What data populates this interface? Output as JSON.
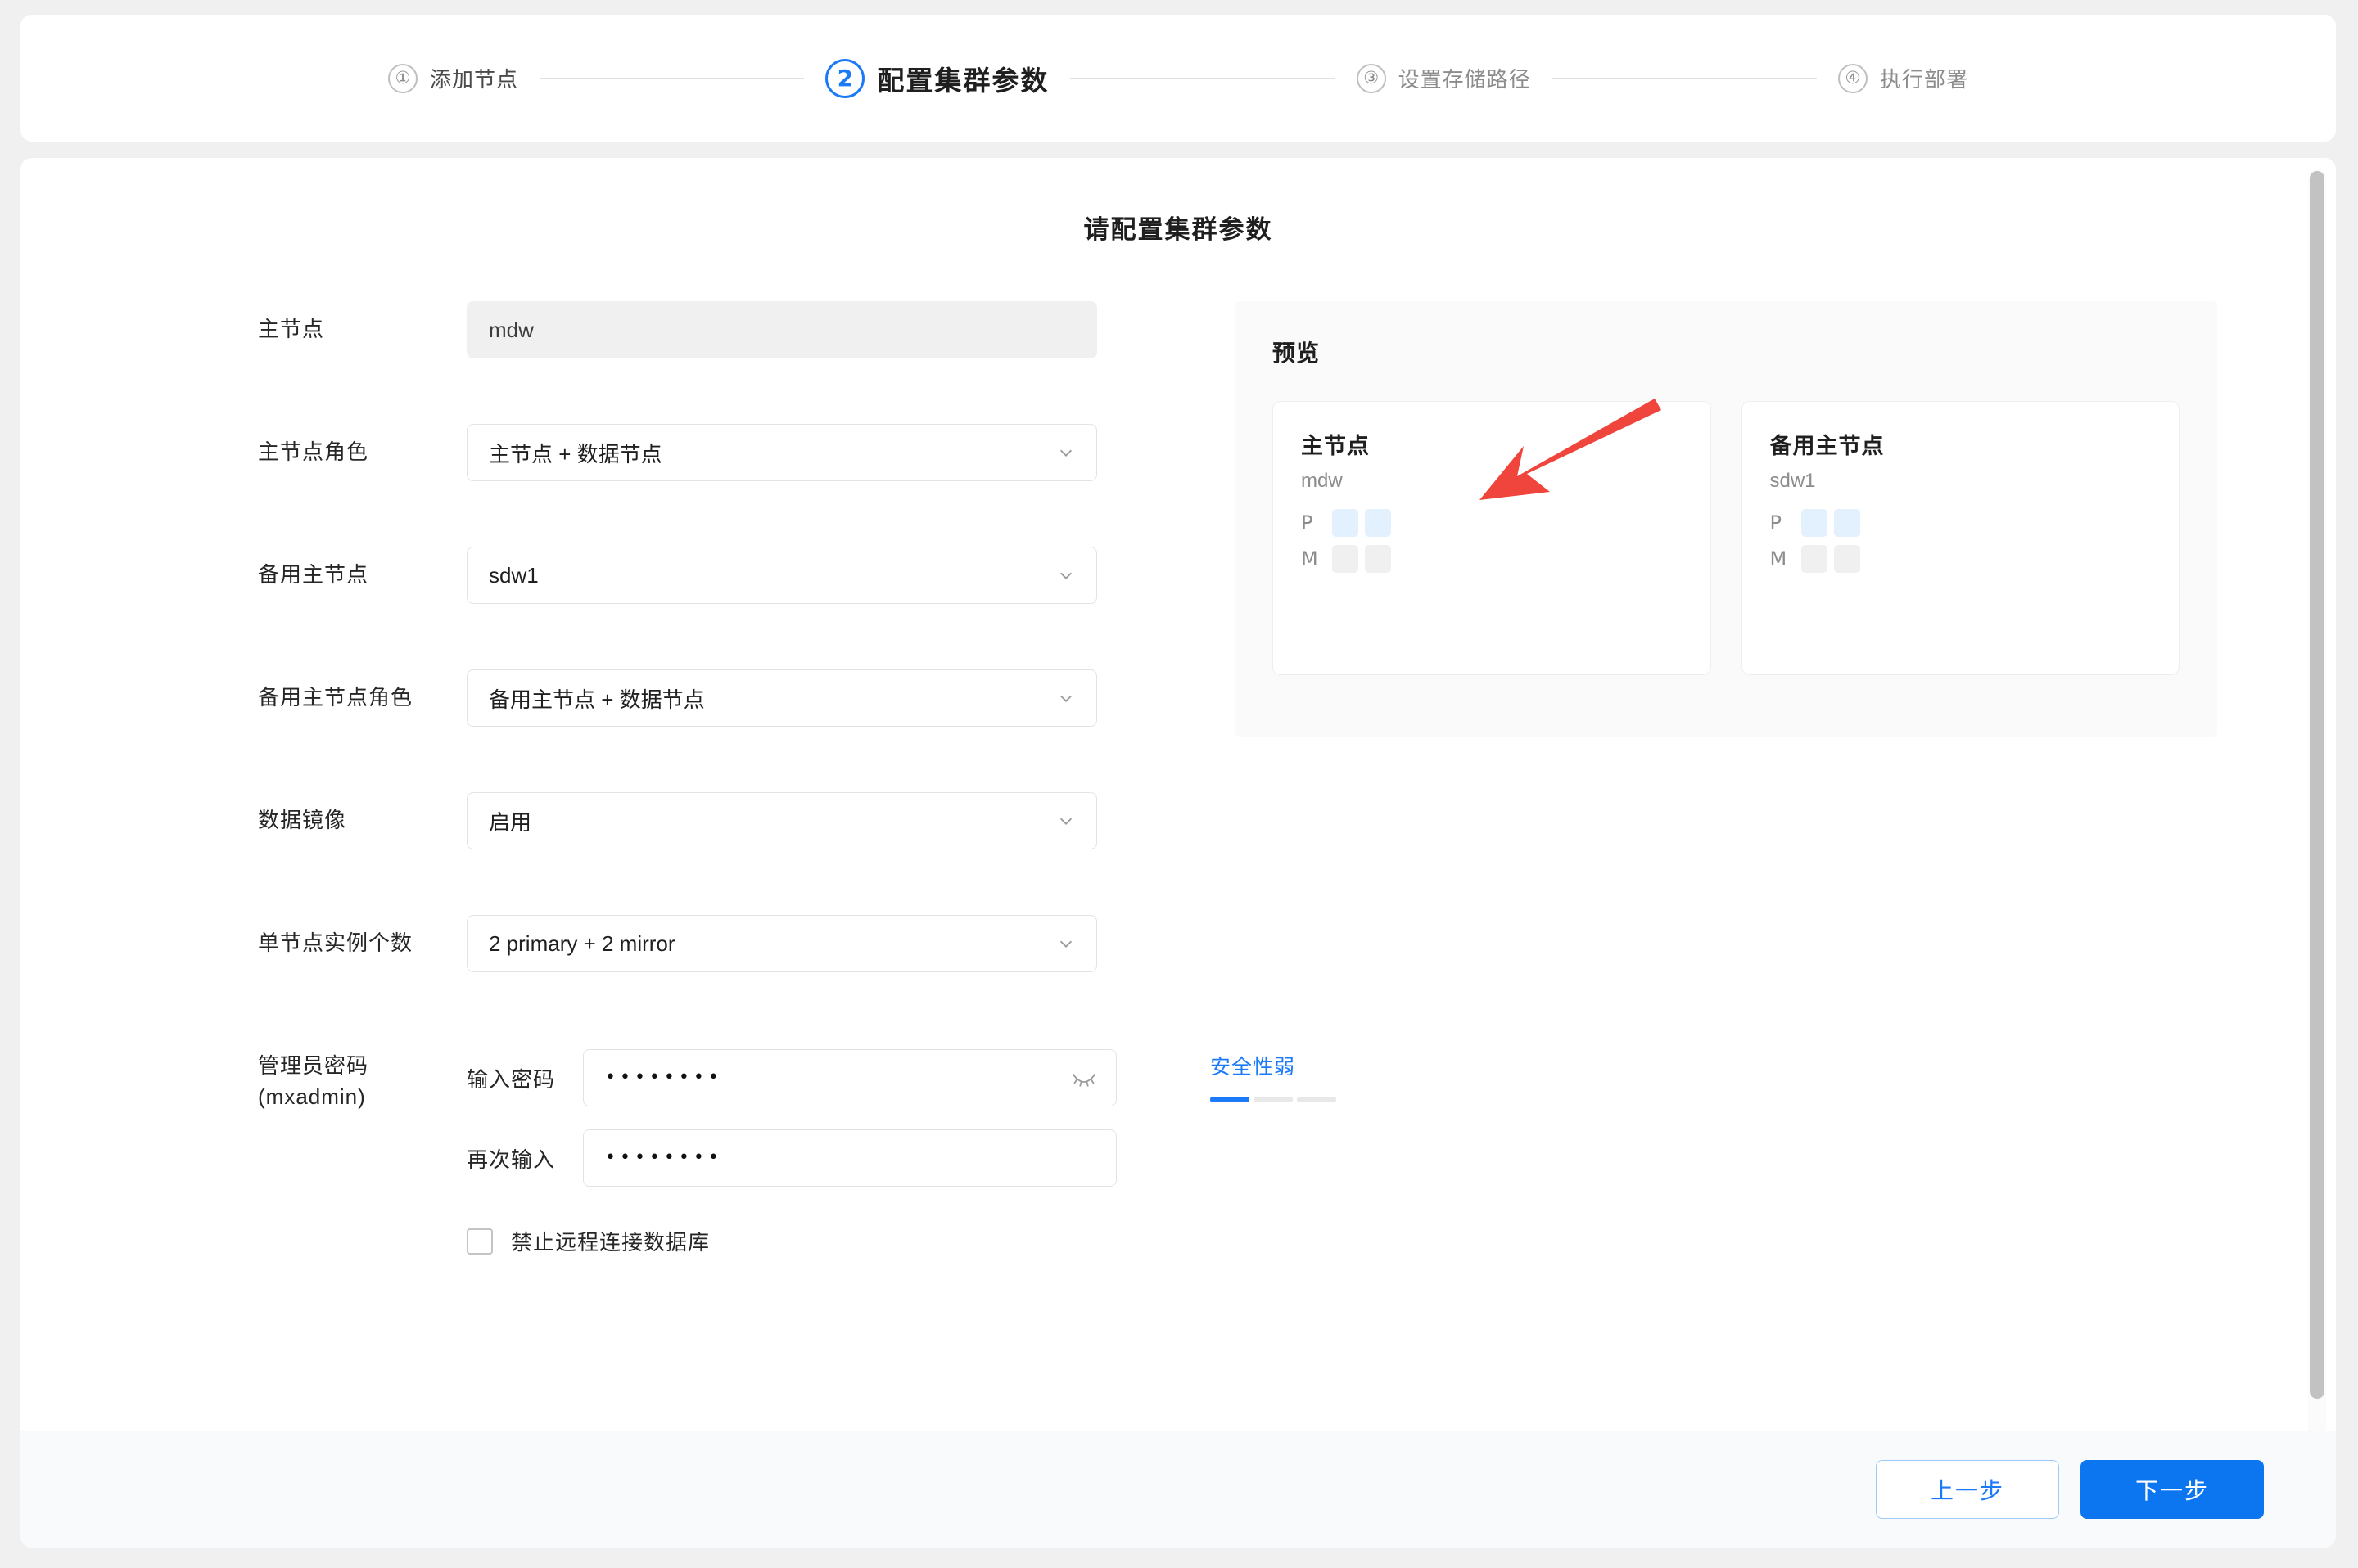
{
  "steps": [
    {
      "num": "①",
      "label": "添加节点",
      "state": "done"
    },
    {
      "num": "2",
      "label": "配置集群参数",
      "state": "active"
    },
    {
      "num": "③",
      "label": "设置存储路径",
      "state": "pending"
    },
    {
      "num": "④",
      "label": "执行部署",
      "state": "pending"
    }
  ],
  "page_title": "请配置集群参数",
  "form": {
    "master_node": {
      "label": "主节点",
      "value": "mdw"
    },
    "master_role": {
      "label": "主节点角色",
      "value": "主节点 + 数据节点"
    },
    "standby_node": {
      "label": "备用主节点",
      "value": "sdw1"
    },
    "standby_role": {
      "label": "备用主节点角色",
      "value": "备用主节点 + 数据节点"
    },
    "data_mirror": {
      "label": "数据镜像",
      "value": "启用"
    },
    "instances_per_node": {
      "label": "单节点实例个数",
      "value": "2 primary + 2 mirror"
    },
    "admin_password": {
      "label_line1": "管理员密码",
      "label_line2": "(mxadmin)",
      "enter_label": "输入密码",
      "enter_value": "••••••••",
      "repeat_label": "再次输入",
      "repeat_value": "••••••••",
      "strength_text": "安全性弱",
      "strength_level": 1,
      "strength_segments": 3,
      "strength_color": "#1a7af8"
    },
    "disable_remote": {
      "label": "禁止远程连接数据库",
      "checked": false
    }
  },
  "preview": {
    "title": "预览",
    "cards": [
      {
        "title": "主节点",
        "host": "mdw",
        "rows": [
          {
            "tag": "P",
            "count": 2,
            "kind": "p"
          },
          {
            "tag": "M",
            "count": 2,
            "kind": "m"
          }
        ]
      },
      {
        "title": "备用主节点",
        "host": "sdw1",
        "rows": [
          {
            "tag": "P",
            "count": 2,
            "kind": "p"
          },
          {
            "tag": "M",
            "count": 2,
            "kind": "m"
          }
        ]
      }
    ]
  },
  "footer": {
    "prev_label": "上一步",
    "next_label": "下一步"
  },
  "colors": {
    "accent": "#1a7af8",
    "primary_button": "#0b76ef",
    "annotation_arrow": "#f0453c",
    "preview_primary_block": "#e3f0fd",
    "preview_mirror_block": "#f0f0f0"
  }
}
